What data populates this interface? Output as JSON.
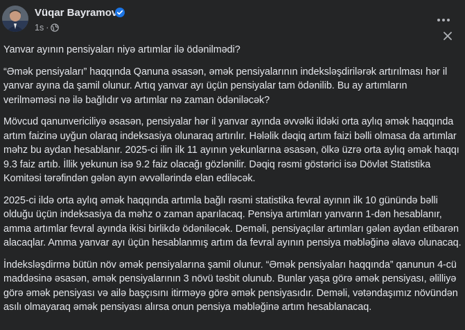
{
  "author": {
    "name": "Vüqar Bayramov",
    "time": "1s",
    "separator": "·"
  },
  "icons": {
    "verified": "verified-badge-icon",
    "audience": "globe-icon",
    "more": "more-options-icon",
    "close": "close-icon"
  },
  "colors": {
    "background": "#242526",
    "text": "#e4e6eb",
    "secondary_text": "#b0b3b8",
    "verified_blue": "#1b74e4"
  },
  "post": {
    "paragraphs": [
      "Yanvar ayının pensiyaları niyə artımlar ilə ödənilmədi?",
      "“Əmək pensiyaları” haqqında Qanuna əsasən, əmək pensiyalarının indeksləşdirilərək artırılması hər il yanvar ayına da şamil olunur. Artıq yanvar ayı üçün pensiyalar tam ödənilib. Bu ay artımların verilməməsi nə ilə bağlıdır və artımlar nə zaman ödəniləcək?",
      "Mövcud qanunvericiliyə əsasən, pensiyalar hər il yanvar ayında əvvəlki ildəki orta aylıq əmək haqqında artım faizinə uyğun olaraq indeksasiya olunaraq artırılır. Hələlik dəqiq artım faizi bəlli olmasa da artımlar məhz bu aydan hesablanır. 2025-ci ilin ilk 11 ayının yekunlarına əsasən, ölkə üzrə orta aylıq əmək haqqı 9.3 faiz artıb. İllik yekunun isə 9.2 faiz olacağı gözlənilir. Dəqiq rəsmi göstərici isə Dövlət Statistika Komitəsi tərəfindən gələn ayın əvvəllərində elan ediləcək.",
      "2025-ci ildə orta aylıq əmək haqqında artımla bağlı rəsmi statistika fevral ayının ilk 10 günündə bəlli olduğu üçün indeksasiya da məhz o zaman aparılacaq. Pensiya artımları yanvarın 1-dən hesablanır, amma artımlar fevral ayında ikisi birlikdə ödəniləcək. Deməli, pensiyaçılar artımları gələn aydan etibarən alacaqlar. Amma yanvar ayı üçün hesablanmış artım da fevral ayının pensiya məbləğinə əlavə olunacaq.",
      "İndeksləşdirmə bütün növ əmək pensiyalarına şamil olunur. “Əmək pensiyaları haqqında” qanunun 4-cü maddəsinə əsasən, əmək pensiyalarının 3 növü təsbit olunub. Bunlar yaşa görə əmək pensiyası, əlilliyə görə əmək pensiyası və ailə başçısını itirməyə görə əmək pensiyasıdır. Deməli, vətəndaşımız növündən asılı olmayaraq əmək pensiyası alırsa onun pensiya məbləğinə artım hesablanacaq."
    ]
  }
}
